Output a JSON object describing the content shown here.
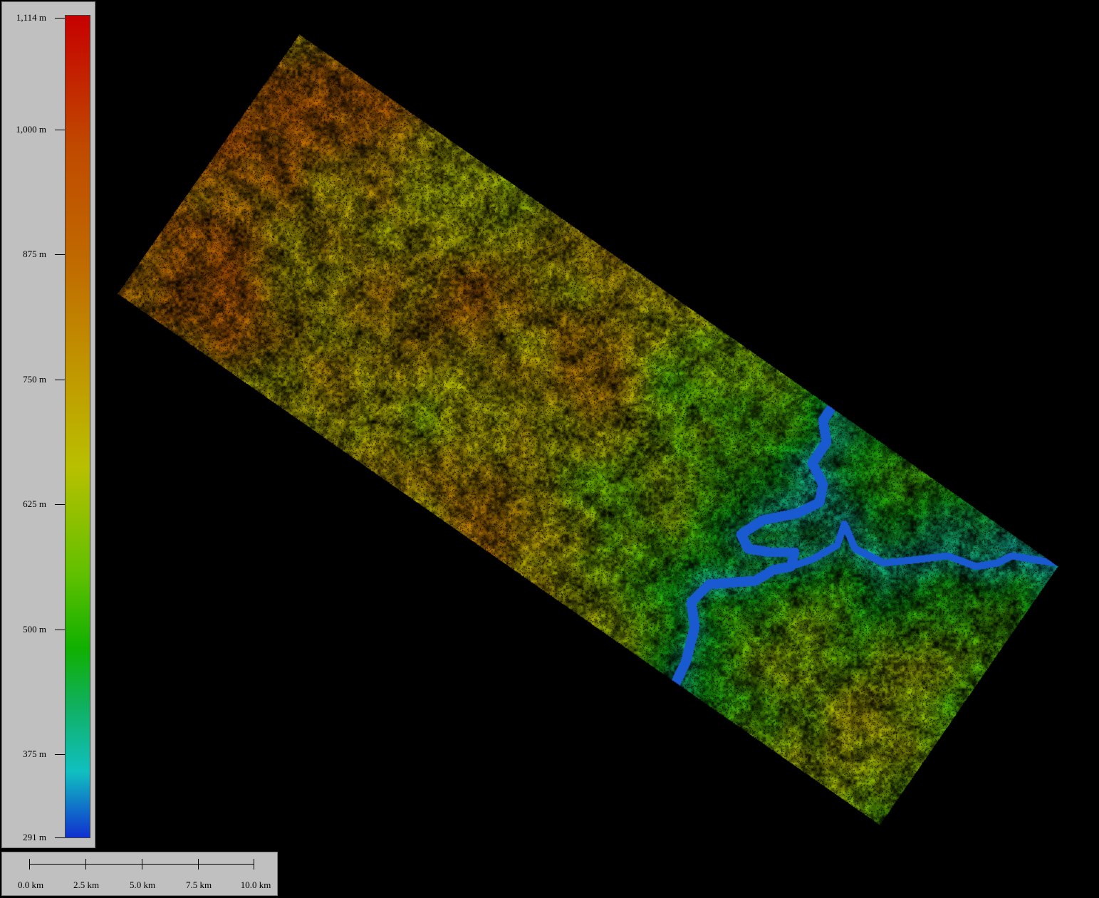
{
  "map": {
    "type": "shaded-relief elevation raster (DEM)",
    "colors": {
      "background": "#000000",
      "high": "#c60000",
      "mid": "#c0b400",
      "low_mid": "#10b000",
      "low": "#10c0c0",
      "lowest": "#1030d0",
      "river": "#1a5ad0"
    }
  },
  "legend": {
    "labels": [
      "1,114 m",
      "1,000 m",
      "875 m",
      "750 m",
      "625 m",
      "500 m",
      "375 m",
      "291 m"
    ],
    "elevations": [
      1114,
      1000,
      875,
      750,
      625,
      500,
      375,
      291
    ]
  },
  "scalebar": {
    "labels": [
      "0.0 km",
      "2.5 km",
      "5.0 km",
      "7.5 km",
      "10.0 km"
    ]
  }
}
